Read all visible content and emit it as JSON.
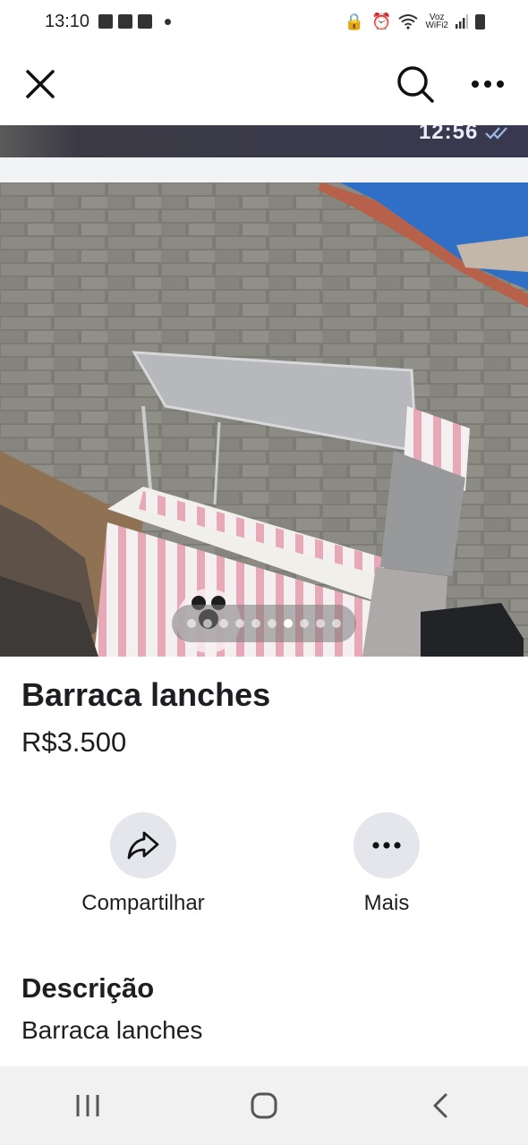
{
  "status": {
    "time": "13:10",
    "network_label_top": "Voz",
    "network_label_bottom": "WiFi2",
    "icons": [
      "gallery-icon",
      "facebook-icon",
      "facebook-icon",
      "dot-icon",
      "lock-icon",
      "alarm-icon",
      "wifi-icon",
      "signal-icon",
      "battery-icon"
    ]
  },
  "toolbar": {
    "close_icon": "close-icon",
    "search_icon": "search-icon",
    "more_icon": "more-horizontal-icon"
  },
  "strip": {
    "time_text": "12:56"
  },
  "carousel": {
    "total": 10,
    "active_index": 6
  },
  "listing": {
    "title": "Barraca lanches",
    "price": "R$3.500"
  },
  "actions": {
    "share_label": "Compartilhar",
    "more_label": "Mais"
  },
  "description": {
    "heading": "Descrição",
    "text": "Barraca lanches"
  },
  "colors": {
    "action_circle_bg": "#e4e6eb",
    "text": "#1c1e21",
    "nav_bg": "#f1f1f1"
  }
}
